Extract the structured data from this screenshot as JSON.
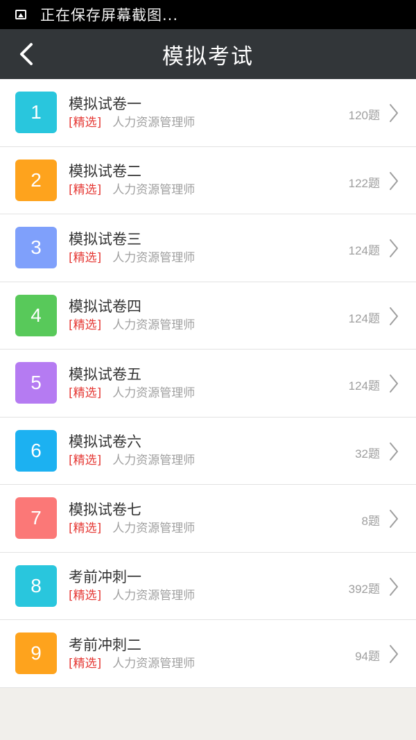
{
  "status_bar": {
    "text": "正在保存屏幕截图..."
  },
  "header": {
    "title": "模拟考试"
  },
  "colors": {
    "status_bar": "#000000",
    "nav_bar": "#323639",
    "tag": "#e53935",
    "badge_cyan": "#29c6dd",
    "badge_orange": "#fea31d",
    "badge_blue": "#7fa0fb",
    "badge_green": "#58c95a",
    "badge_purple": "#b57bf2",
    "badge_sky": "#1cb1f1",
    "badge_red": "#fb7877"
  },
  "items": [
    {
      "number": "1",
      "title": "模拟试卷一",
      "tag": "[精选]",
      "category": "人力资源管理师",
      "count": "120题",
      "color": "#29c6dd"
    },
    {
      "number": "2",
      "title": "模拟试卷二",
      "tag": "[精选]",
      "category": "人力资源管理师",
      "count": "122题",
      "color": "#fea31d"
    },
    {
      "number": "3",
      "title": "模拟试卷三",
      "tag": "[精选]",
      "category": "人力资源管理师",
      "count": "124题",
      "color": "#7fa0fb"
    },
    {
      "number": "4",
      "title": "模拟试卷四",
      "tag": "[精选]",
      "category": "人力资源管理师",
      "count": "124题",
      "color": "#58c95a"
    },
    {
      "number": "5",
      "title": "模拟试卷五",
      "tag": "[精选]",
      "category": "人力资源管理师",
      "count": "124题",
      "color": "#b57bf2"
    },
    {
      "number": "6",
      "title": "模拟试卷六",
      "tag": "[精选]",
      "category": "人力资源管理师",
      "count": "32题",
      "color": "#1cb1f1"
    },
    {
      "number": "7",
      "title": "模拟试卷七",
      "tag": "[精选]",
      "category": "人力资源管理师",
      "count": "8题",
      "color": "#fb7877"
    },
    {
      "number": "8",
      "title": "考前冲刺一",
      "tag": "[精选]",
      "category": "人力资源管理师",
      "count": "392题",
      "color": "#29c6dd"
    },
    {
      "number": "9",
      "title": "考前冲刺二",
      "tag": "[精选]",
      "category": "人力资源管理师",
      "count": "94题",
      "color": "#fea31d"
    }
  ]
}
